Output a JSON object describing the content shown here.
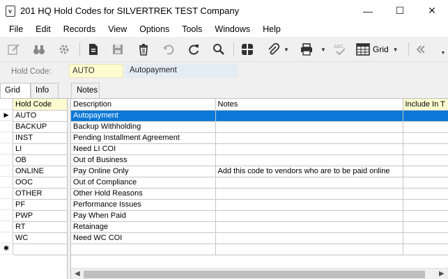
{
  "window": {
    "title": "201 HQ Hold Codes for SILVERTREK TEST Company",
    "minimize": "—",
    "maximize": "☐",
    "close": "✕"
  },
  "menu": [
    "File",
    "Edit",
    "Records",
    "View",
    "Options",
    "Tools",
    "Windows",
    "Help"
  ],
  "toolbar": {
    "grid_label": "Grid",
    "icons": [
      "edit-icon",
      "binoculars-icon",
      "gear-icon",
      "document-icon",
      "save-icon",
      "trash-icon",
      "undo-icon",
      "refresh-icon",
      "search-icon",
      "calculator-icon",
      "attach-icon",
      "print-icon",
      "spellcheck-icon",
      "grid-icon",
      "collapse-icon"
    ]
  },
  "header": {
    "hold_code_label": "Hold Code:",
    "hold_code_value": "AUTO",
    "description_value": "Autopayment"
  },
  "tabs": [
    "Grid",
    "Info",
    "Notes"
  ],
  "grid": {
    "columns": {
      "hold_code": "Hold Code",
      "description": "Description",
      "notes": "Notes",
      "include": "Include In T"
    },
    "rows": [
      {
        "code": "AUTO",
        "description": "Autopayment",
        "notes": ""
      },
      {
        "code": "BACKUP",
        "description": "Backup Withholding",
        "notes": ""
      },
      {
        "code": "INST",
        "description": "Pending Installment Agreement",
        "notes": ""
      },
      {
        "code": "LI",
        "description": "Need LI COI",
        "notes": ""
      },
      {
        "code": "OB",
        "description": "Out of Business",
        "notes": ""
      },
      {
        "code": "ONLINE",
        "description": "Pay Online Only",
        "notes": "Add this code to vendors who are to be paid online"
      },
      {
        "code": "OOC",
        "description": "Out of Compliance",
        "notes": ""
      },
      {
        "code": "OTHER",
        "description": "Other Hold Reasons",
        "notes": ""
      },
      {
        "code": "PF",
        "description": "Performance Issues",
        "notes": ""
      },
      {
        "code": "PWP",
        "description": "Pay When Paid",
        "notes": ""
      },
      {
        "code": "RT",
        "description": "Retainage",
        "notes": ""
      },
      {
        "code": "WC",
        "description": "Need WC COI",
        "notes": ""
      }
    ],
    "current_row_marker": "▶",
    "new_row_marker": "✱"
  }
}
